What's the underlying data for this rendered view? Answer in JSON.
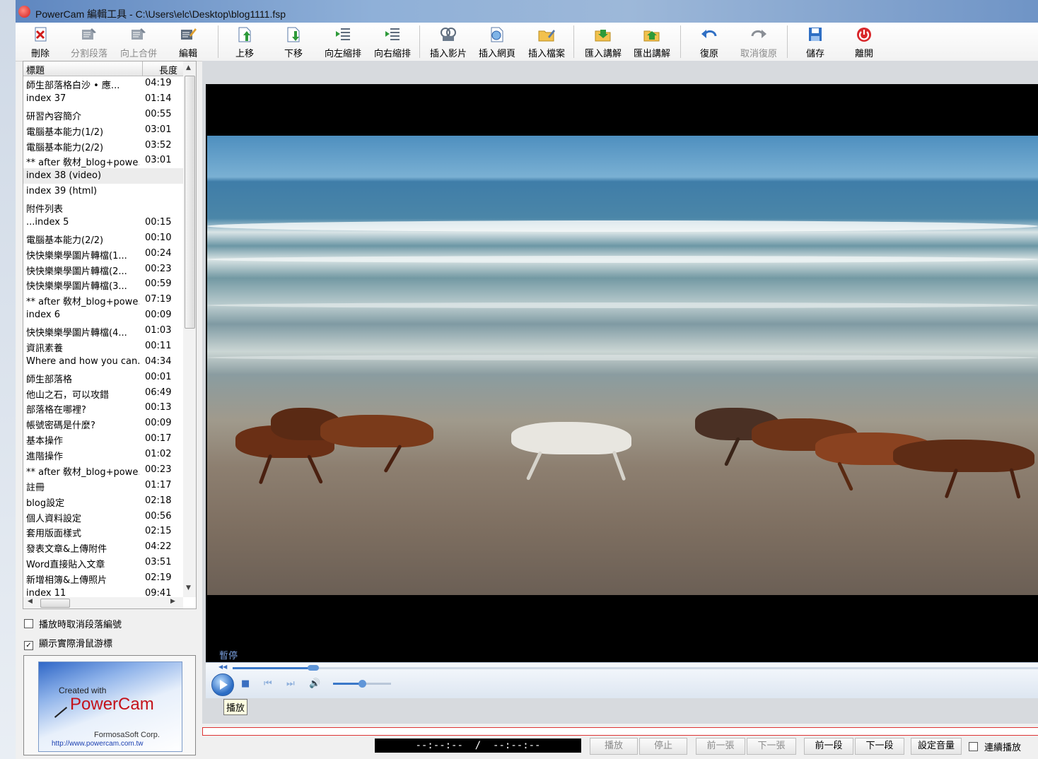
{
  "window": {
    "title": "PowerCam 編輯工具 - C:\\Users\\elc\\Desktop\\blog1111.fsp",
    "icon": "powercam-app-icon"
  },
  "toolbar": {
    "items": [
      {
        "id": "delete",
        "label": "刪除",
        "icon": "delete-icon",
        "enabled": true
      },
      {
        "id": "split",
        "label": "分割段落",
        "icon": "split-icon",
        "enabled": false
      },
      {
        "id": "merge",
        "label": "向上合併",
        "icon": "merge-icon",
        "enabled": false
      },
      {
        "id": "edit",
        "label": "編輯",
        "icon": "edit-icon",
        "enabled": true
      },
      {
        "id": "moveup",
        "label": "上移",
        "icon": "move-up-icon",
        "enabled": true
      },
      {
        "id": "movedown",
        "label": "下移",
        "icon": "move-down-icon",
        "enabled": true
      },
      {
        "id": "outdent",
        "label": "向左縮排",
        "icon": "outdent-icon",
        "enabled": true
      },
      {
        "id": "indent",
        "label": "向右縮排",
        "icon": "indent-icon",
        "enabled": true
      },
      {
        "id": "insvideo",
        "label": "插入影片",
        "icon": "insert-video-icon",
        "enabled": true
      },
      {
        "id": "insweb",
        "label": "插入網頁",
        "icon": "insert-web-icon",
        "enabled": true
      },
      {
        "id": "insfile",
        "label": "插入檔案",
        "icon": "insert-file-icon",
        "enabled": true
      },
      {
        "id": "importnar",
        "label": "匯入講解",
        "icon": "import-narration-icon",
        "enabled": true
      },
      {
        "id": "exportnar",
        "label": "匯出講解",
        "icon": "export-narration-icon",
        "enabled": true
      },
      {
        "id": "undo",
        "label": "復原",
        "icon": "undo-icon",
        "enabled": true
      },
      {
        "id": "redo",
        "label": "取消復原",
        "icon": "redo-icon",
        "enabled": false
      },
      {
        "id": "save",
        "label": "儲存",
        "icon": "save-icon",
        "enabled": true
      },
      {
        "id": "exit",
        "label": "離開",
        "icon": "power-icon",
        "enabled": true
      }
    ]
  },
  "list": {
    "col_title": "標題",
    "col_length": "長度",
    "rows": [
      {
        "title": "師生部落格白沙 • 應...",
        "len": "04:19"
      },
      {
        "title": "index 37",
        "len": "01:14"
      },
      {
        "title": "研習內容簡介",
        "len": "00:55"
      },
      {
        "title": "電腦基本能力(1/2)",
        "len": "03:01"
      },
      {
        "title": "電腦基本能力(2/2)",
        "len": "03:52"
      },
      {
        "title": "** after 敎材_blog+powe...",
        "len": "03:01"
      },
      {
        "title": "index 38 (video)",
        "len": "",
        "selected": true
      },
      {
        "title": "index 39 (html)",
        "len": ""
      },
      {
        "title": "附件列表",
        "len": ""
      },
      {
        "title": "...index 5",
        "len": "00:15"
      },
      {
        "title": "電腦基本能力(2/2)",
        "len": "00:10"
      },
      {
        "title": "快快樂樂學圖片轉檔(1...",
        "len": "00:24"
      },
      {
        "title": "快快樂樂學圖片轉檔(2...",
        "len": "00:23"
      },
      {
        "title": "快快樂樂學圖片轉檔(3...",
        "len": "00:59"
      },
      {
        "title": "** after 敎材_blog+powe...",
        "len": "07:19"
      },
      {
        "title": "index 6",
        "len": "00:09"
      },
      {
        "title": "快快樂樂學圖片轉檔(4...",
        "len": "01:03"
      },
      {
        "title": "資訊素養",
        "len": "00:11"
      },
      {
        "title": "Where and how you can...",
        "len": "04:34"
      },
      {
        "title": "師生部落格",
        "len": "00:01"
      },
      {
        "title": "他山之石，可以攻錯",
        "len": "06:49"
      },
      {
        "title": "部落格在哪裡?",
        "len": "00:13"
      },
      {
        "title": "帳號密碼是什麼?",
        "len": "00:09"
      },
      {
        "title": "基本操作",
        "len": "00:17"
      },
      {
        "title": "進階操作",
        "len": "01:02"
      },
      {
        "title": "** after 敎材_blog+powe...",
        "len": "00:23"
      },
      {
        "title": "註冊",
        "len": "01:17"
      },
      {
        "title": "blog設定",
        "len": "02:18"
      },
      {
        "title": "個人資料設定",
        "len": "00:56"
      },
      {
        "title": "套用版面樣式",
        "len": "02:15"
      },
      {
        "title": "發表文章&上傳附件",
        "len": "04:22"
      },
      {
        "title": "Word直接貼入文章",
        "len": "03:51"
      },
      {
        "title": "新增相簿&上傳照片",
        "len": "02:19"
      },
      {
        "title": "index 11",
        "len": "09:41"
      }
    ]
  },
  "options": {
    "cancel_numbering": {
      "label": "播放時取消段落編號",
      "checked": false
    },
    "show_cursor": {
      "label": "顯示實際滑鼠游標",
      "checked": true
    }
  },
  "logo": {
    "created_with": "Created with",
    "brand": "PowerCam",
    "company": "FormosaSoft Corp.",
    "url": "http://www.powercam.com.tw"
  },
  "player": {
    "status": "暫停",
    "tooltip": "播放",
    "seek_fraction": 0.1,
    "volume_fraction": 0.5
  },
  "bottom": {
    "time": "--:--:--  /  --:--:--",
    "buttons": [
      {
        "label": "播放",
        "enabled": false
      },
      {
        "label": "停止",
        "enabled": false
      },
      {
        "label": "前一張",
        "enabled": false
      },
      {
        "label": "下一張",
        "enabled": false
      },
      {
        "label": "前一段",
        "enabled": true
      },
      {
        "label": "下一段",
        "enabled": true
      },
      {
        "label": "設定音量",
        "enabled": true
      }
    ],
    "continuous": {
      "label": "連續播放",
      "checked": false
    }
  }
}
